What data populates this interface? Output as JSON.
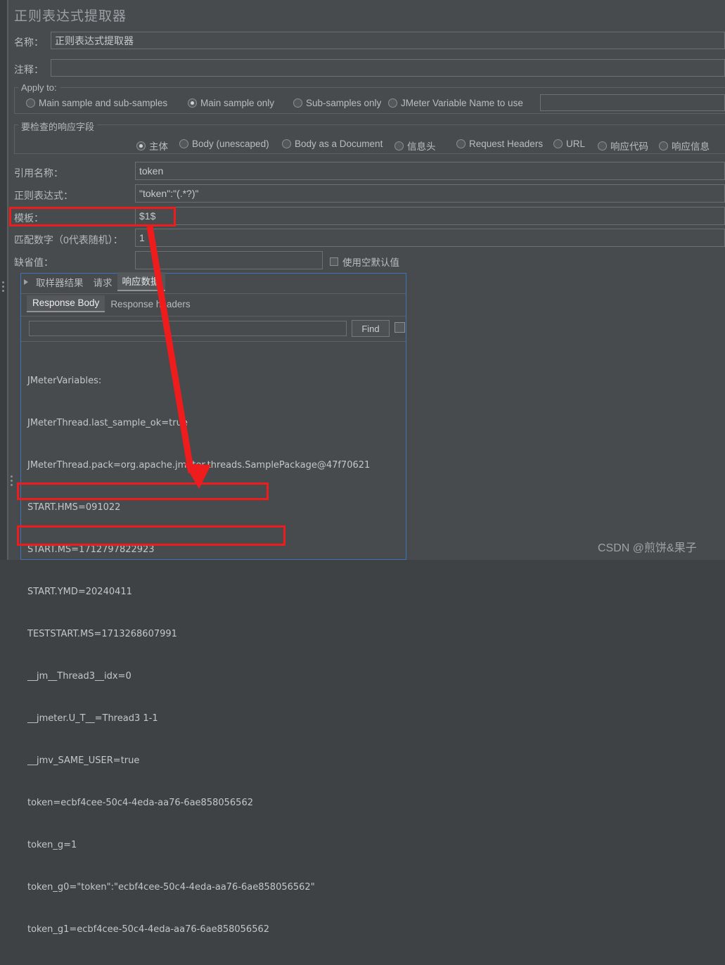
{
  "window": {
    "title": "正则表达式提取器"
  },
  "form": {
    "name_label": "名称：",
    "name_value": "正则表达式提取器",
    "comment_label": "注释：",
    "comment_value": "",
    "apply_to_label": "Apply to:",
    "apply_to_options": [
      {
        "label": "Main sample and sub-samples",
        "selected": false
      },
      {
        "label": "Main sample only",
        "selected": true
      },
      {
        "label": "Sub-samples only",
        "selected": false
      },
      {
        "label": "JMeter Variable Name to use",
        "selected": false
      }
    ],
    "jmeter_variable_value": "",
    "field_to_check_label": "要检查的响应字段",
    "field_to_check_options": [
      {
        "label": "主体",
        "selected": true
      },
      {
        "label": "Body (unescaped)",
        "selected": false
      },
      {
        "label": "Body as a Document",
        "selected": false
      },
      {
        "label": "信息头",
        "selected": false
      },
      {
        "label": "Request Headers",
        "selected": false
      },
      {
        "label": "URL",
        "selected": false
      },
      {
        "label": "响应代码",
        "selected": false
      },
      {
        "label": "响应信息",
        "selected": false
      }
    ],
    "reference_name_label": "引用名称：",
    "reference_name_value": "token",
    "regex_label": "正则表达式：",
    "regex_value": "\"token\":\"(.*?)\"",
    "template_label": "模板：",
    "template_value": "$1$",
    "match_no_label": "匹配数字（0代表随机）：",
    "match_no_value": "1",
    "default_value_label": "缺省值：",
    "default_value_value": "",
    "use_empty_default_label": "使用空默认值",
    "use_empty_default_checked": false
  },
  "results": {
    "tabs": [
      {
        "label": "取样器结果",
        "selected": false
      },
      {
        "label": "请求",
        "selected": false
      },
      {
        "label": "响应数据",
        "selected": true
      }
    ],
    "subtabs": [
      {
        "label": "Response Body",
        "selected": true
      },
      {
        "label": "Response headers",
        "selected": false
      }
    ],
    "search_value": "",
    "find_button_label": "Find",
    "case_checkbox_checked": false,
    "body_lines": [
      "JMeterVariables:",
      "JMeterThread.last_sample_ok=true",
      "JMeterThread.pack=org.apache.jmeter.threads.SamplePackage@47f70621",
      "START.HMS=091022",
      "START.MS=1712797822923",
      "START.YMD=20240411",
      "TESTSTART.MS=1713268607991",
      "__jm__Thread3__idx=0",
      "__jmeter.U_T__=Thread3 1-1",
      "__jmv_SAME_USER=true",
      "token=ecbf4cee-50c4-4eda-aa76-6ae858056562",
      "token_g=1",
      "token_g0=\"token\":\"ecbf4cee-50c4-4eda-aa76-6ae858056562\"",
      "token_g1=ecbf4cee-50c4-4eda-aa76-6ae858056562"
    ]
  },
  "annotations": {
    "highlight_color": "#ee1c1c",
    "boxes": [
      {
        "name": "template-row-highlight"
      },
      {
        "name": "token-line-highlight"
      },
      {
        "name": "token-g1-line-highlight"
      }
    ],
    "arrow": {
      "name": "template-to-token-arrow"
    }
  },
  "watermark": {
    "text": "CSDN @煎饼&果子"
  },
  "colors": {
    "background": "#484b4d",
    "panel_focus_border": "#3d73b8",
    "text": "#b8bcbd"
  }
}
